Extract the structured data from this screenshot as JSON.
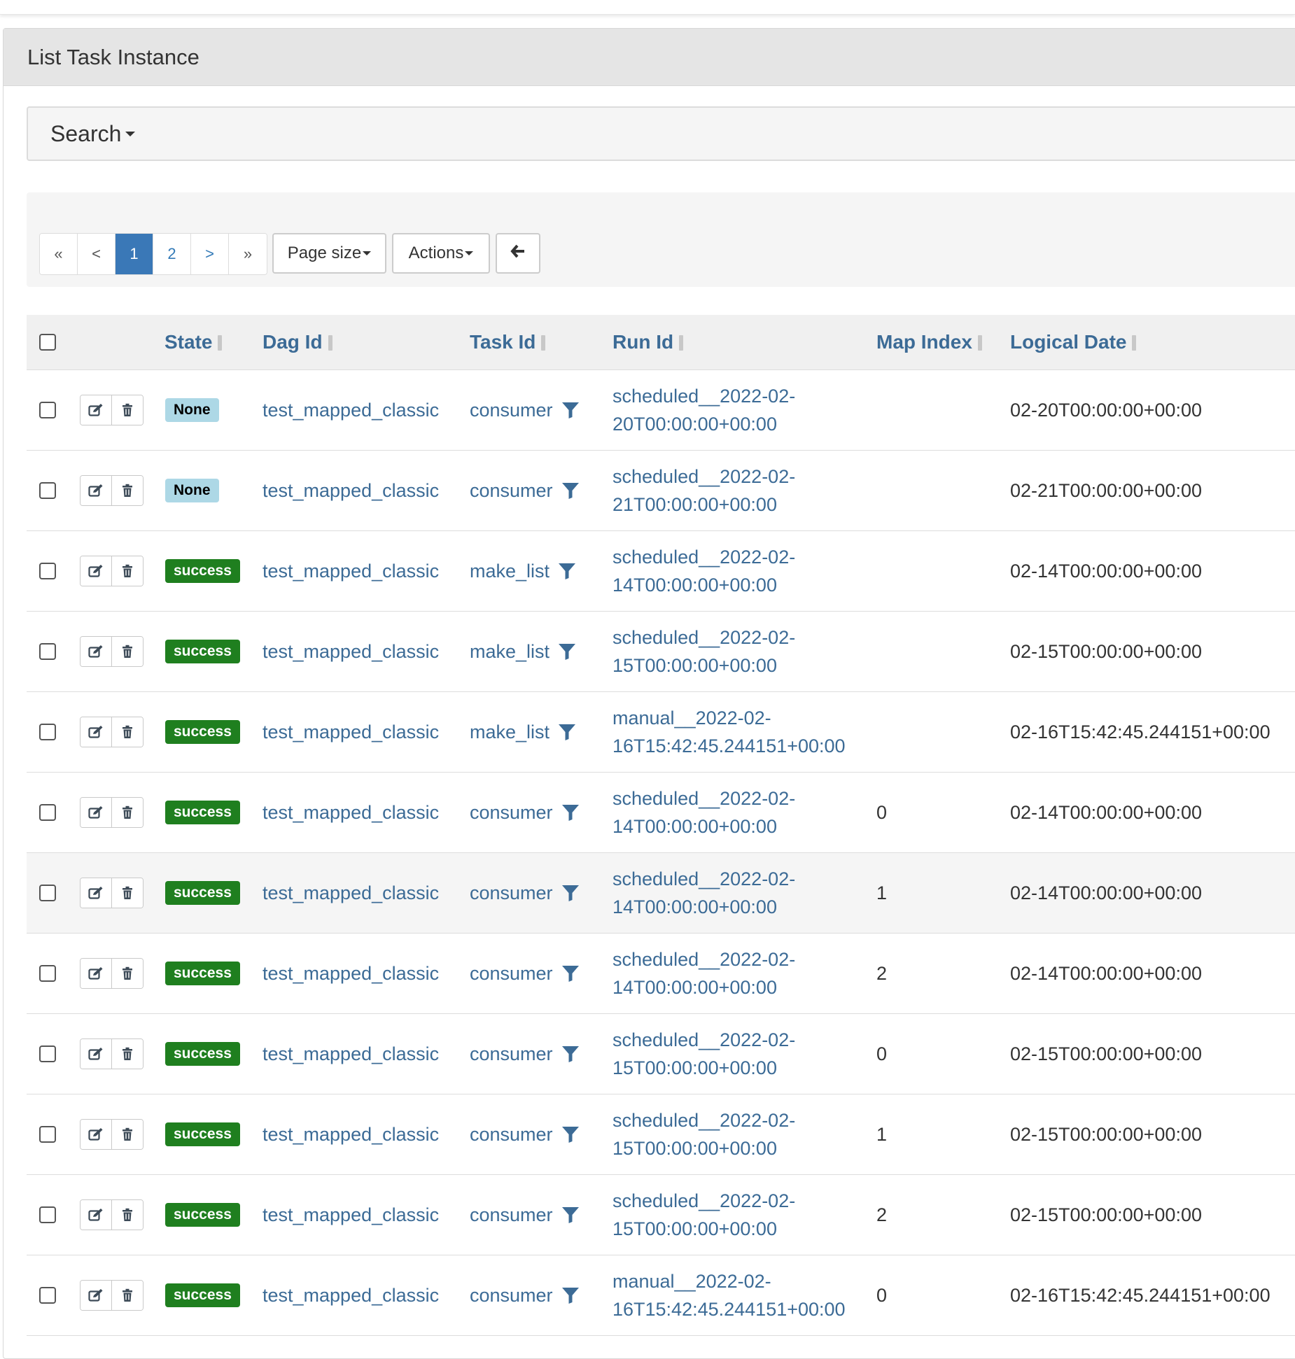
{
  "panel": {
    "title": "List Task Instance"
  },
  "search": {
    "label": "Search"
  },
  "pagination": {
    "first": "«",
    "prev": "<",
    "pages": [
      "1",
      "2"
    ],
    "current_page": "1",
    "next": ">",
    "last": "»"
  },
  "toolbar": {
    "page_size_label": "Page size",
    "actions_label": "Actions",
    "back_icon": "arrow-left-icon"
  },
  "table": {
    "columns": {
      "state": "State",
      "dag_id": "Dag Id",
      "task_id": "Task Id",
      "run_id": "Run Id",
      "map_index": "Map Index",
      "logical_date": "Logical Date"
    },
    "rows": [
      {
        "state": "None",
        "dag_id": "test_mapped_classic",
        "task_id": "consumer",
        "run_id_1": "scheduled__2022-02-",
        "run_id_2": "20T00:00:00+00:00",
        "map_index": "",
        "logical_date": "02-20T00:00:00+00:00"
      },
      {
        "state": "None",
        "dag_id": "test_mapped_classic",
        "task_id": "consumer",
        "run_id_1": "scheduled__2022-02-",
        "run_id_2": "21T00:00:00+00:00",
        "map_index": "",
        "logical_date": "02-21T00:00:00+00:00"
      },
      {
        "state": "success",
        "dag_id": "test_mapped_classic",
        "task_id": "make_list",
        "run_id_1": "scheduled__2022-02-",
        "run_id_2": "14T00:00:00+00:00",
        "map_index": "",
        "logical_date": "02-14T00:00:00+00:00"
      },
      {
        "state": "success",
        "dag_id": "test_mapped_classic",
        "task_id": "make_list",
        "run_id_1": "scheduled__2022-02-",
        "run_id_2": "15T00:00:00+00:00",
        "map_index": "",
        "logical_date": "02-15T00:00:00+00:00"
      },
      {
        "state": "success",
        "dag_id": "test_mapped_classic",
        "task_id": "make_list",
        "run_id_1": "manual__2022-02-",
        "run_id_2": "16T15:42:45.244151+00:00",
        "map_index": "",
        "logical_date": "02-16T15:42:45.244151+00:00"
      },
      {
        "state": "success",
        "dag_id": "test_mapped_classic",
        "task_id": "consumer",
        "run_id_1": "scheduled__2022-02-",
        "run_id_2": "14T00:00:00+00:00",
        "map_index": "0",
        "logical_date": "02-14T00:00:00+00:00"
      },
      {
        "state": "success",
        "dag_id": "test_mapped_classic",
        "task_id": "consumer",
        "run_id_1": "scheduled__2022-02-",
        "run_id_2": "14T00:00:00+00:00",
        "map_index": "1",
        "logical_date": "02-14T00:00:00+00:00"
      },
      {
        "state": "success",
        "dag_id": "test_mapped_classic",
        "task_id": "consumer",
        "run_id_1": "scheduled__2022-02-",
        "run_id_2": "14T00:00:00+00:00",
        "map_index": "2",
        "logical_date": "02-14T00:00:00+00:00"
      },
      {
        "state": "success",
        "dag_id": "test_mapped_classic",
        "task_id": "consumer",
        "run_id_1": "scheduled__2022-02-",
        "run_id_2": "15T00:00:00+00:00",
        "map_index": "0",
        "logical_date": "02-15T00:00:00+00:00"
      },
      {
        "state": "success",
        "dag_id": "test_mapped_classic",
        "task_id": "consumer",
        "run_id_1": "scheduled__2022-02-",
        "run_id_2": "15T00:00:00+00:00",
        "map_index": "1",
        "logical_date": "02-15T00:00:00+00:00"
      },
      {
        "state": "success",
        "dag_id": "test_mapped_classic",
        "task_id": "consumer",
        "run_id_1": "scheduled__2022-02-",
        "run_id_2": "15T00:00:00+00:00",
        "map_index": "2",
        "logical_date": "02-15T00:00:00+00:00"
      },
      {
        "state": "success",
        "dag_id": "test_mapped_classic",
        "task_id": "consumer",
        "run_id_1": "manual__2022-02-",
        "run_id_2": "16T15:42:45.244151+00:00",
        "map_index": "0",
        "logical_date": "02-16T15:42:45.244151+00:00"
      }
    ]
  },
  "icons": {
    "edit": "edit-icon",
    "delete": "trash-icon",
    "filter": "filter-icon"
  },
  "colors": {
    "state_none": "#add8e6",
    "state_success": "#1f7f1f",
    "link": "#3c6b96",
    "active_page": "#3a78b7"
  }
}
